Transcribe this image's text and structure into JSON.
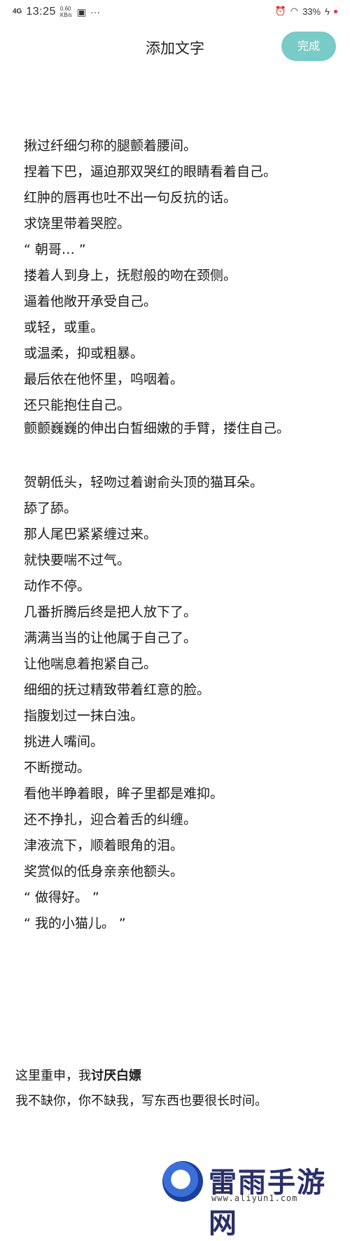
{
  "status_bar": {
    "signal": "4G",
    "time": "13:25",
    "speed": "0.60 KB/s",
    "battery": "33%"
  },
  "header": {
    "title": "添加文字",
    "done_label": "完成"
  },
  "story_lines": [
    "揪过纤细匀称的腿颤着腰间。",
    "捏着下巴，逼迫那双哭红的眼睛看着自己。",
    "红肿的唇再也吐不出一句反抗的话。",
    "求饶里带着哭腔。",
    "“ 朝哥… ”",
    "搂着人到身上，抚慰般的吻在颈侧。",
    "逼着他敞开承受自己。",
    "或轻，或重。",
    "或温柔，抑或粗暴。",
    "最后依在他怀里，呜咽着。",
    "还只能抱住自己。",
    "颤颤巍巍的伸出白皙细嫩的手臂，搂住自己。",
    "贺朝低头，轻吻过着谢俞头顶的猫耳朵。",
    "舔了舔。",
    "那人尾巴紧紧缠过来。",
    "就快要喘不过气。",
    "动作不停。",
    "几番折腾后终是把人放下了。",
    "满满当当的让他属于自己了。",
    "让他喘息着抱紧自己。",
    "细细的抚过精致带着红意的脸。",
    "指腹划过一抹白浊。",
    "挑进人嘴间。",
    "不断搅动。",
    "看他半睁着眼，眸子里都是难抑。",
    "还不挣扎，迎合着舌的纠缠。",
    "津液流下，顺着眼角的泪。",
    "奖赏似的低身亲亲他额头。",
    "“ 做得好。 ”",
    "“ 我的小猫儿。 ”"
  ],
  "note": {
    "line1_prefix": "这里重申，我",
    "line1_bold": "讨厌白嫖",
    "line2": "我不缺你，你不缺我，写东西也要很长时间。"
  },
  "watermark": {
    "name": "雷雨手游网",
    "url": "www.aliyun1.com"
  }
}
